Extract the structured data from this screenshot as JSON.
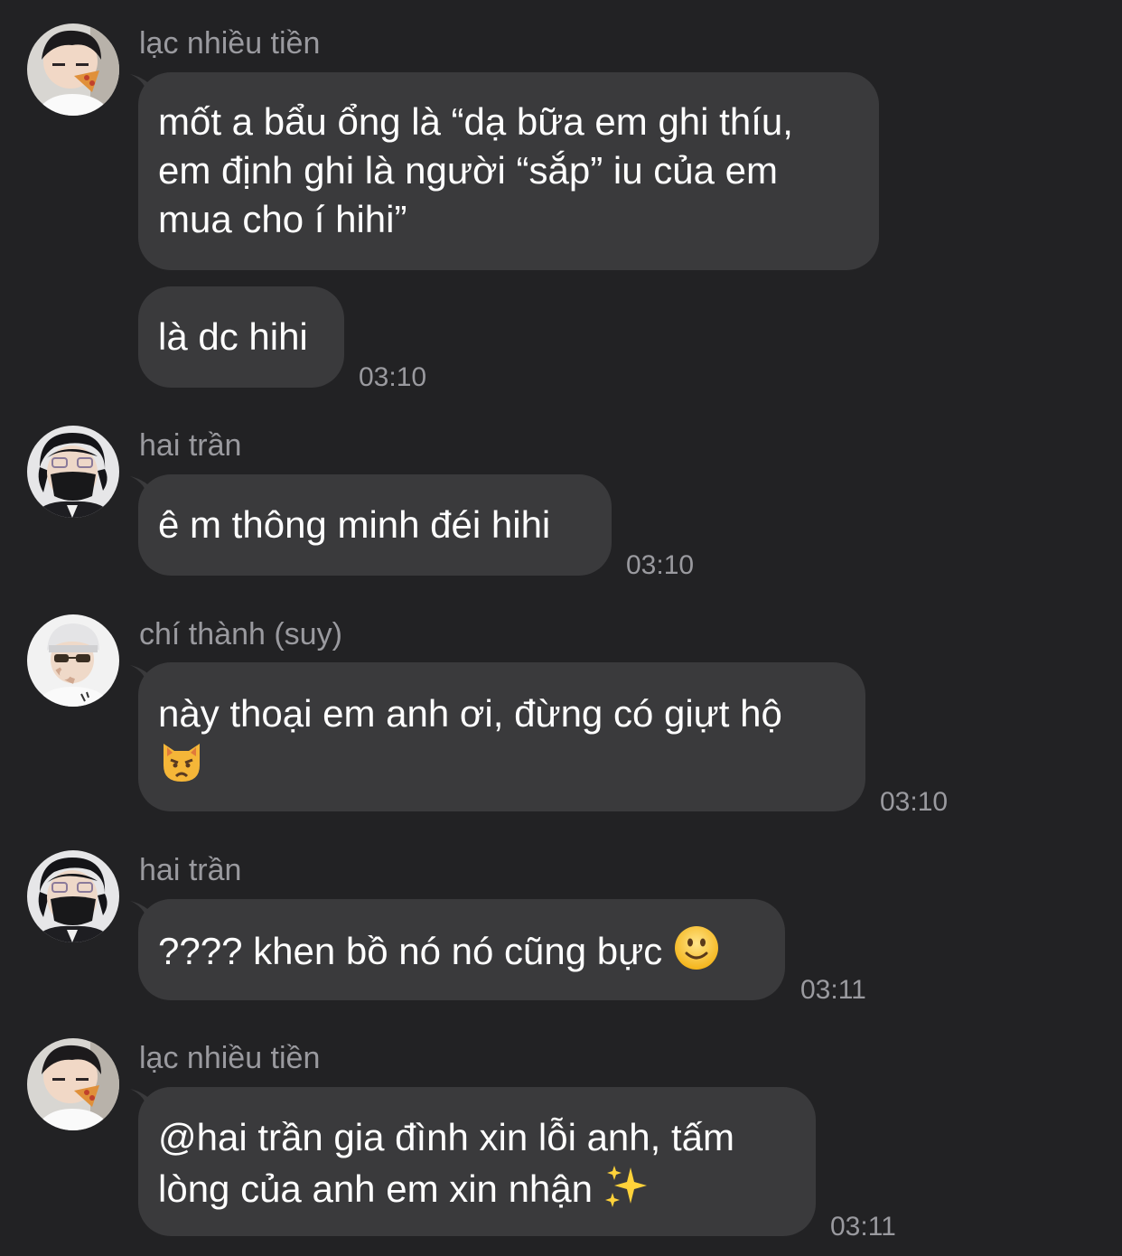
{
  "messages": [
    {
      "sender": "lạc nhiều tiền",
      "avatar": "avatar-lac",
      "bubbles": [
        {
          "text": "mốt a bẩu ổng là “dạ bữa em ghi thíu,\nem định ghi là người “sắp” iu của em\nmua cho í hihi”"
        },
        {
          "text": "là dc hihi",
          "time": "03:10"
        }
      ]
    },
    {
      "sender": "hai trần",
      "avatar": "avatar-hai",
      "bubbles": [
        {
          "text": "ê m thông minh đéi hihi",
          "time": "03:10"
        }
      ]
    },
    {
      "sender": "chí thành (suy)",
      "avatar": "avatar-chi-thanh",
      "bubbles": [
        {
          "text": "này thoại em anh ơi, đừng có giựt hộ",
          "emoji": "pouting-cat-emoji",
          "time": "03:10"
        }
      ]
    },
    {
      "sender": "hai trần",
      "avatar": "avatar-hai",
      "bubbles": [
        {
          "text": "???? khen bồ nó nó cũng bực",
          "emoji": "slightly-smiling-face-emoji",
          "time": "03:11"
        }
      ]
    },
    {
      "sender": "lạc nhiều tiền",
      "avatar": "avatar-lac",
      "bubbles": [
        {
          "text": "@hai trần gia đình xin lỗi anh, tấm\nlòng của anh em xin nhận",
          "emoji": "sparkles-emoji",
          "time": "03:11"
        }
      ]
    }
  ],
  "colors": {
    "background": "#222224",
    "bubble": "#3a3a3c",
    "text": "#ffffff",
    "meta": "#9a9a9f"
  }
}
